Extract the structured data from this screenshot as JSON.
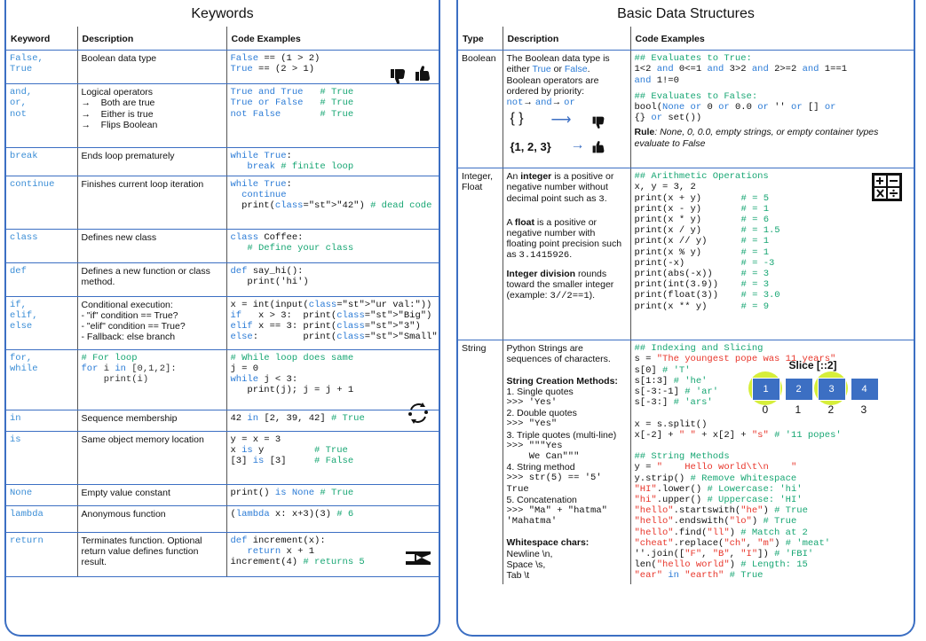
{
  "left": {
    "title": "Keywords",
    "headers": [
      "Keyword",
      "Description",
      "Code Examples"
    ],
    "rows": [
      {
        "kw": "False,\nTrue",
        "desc": "Boolean data type",
        "code": "False == (1 > 2)\nTrue == (2 > 1)"
      },
      {
        "kw": "and,\nor,\nnot",
        "desc": "Logical operators\n→    Both are true\n→    Either is true\n→    Flips Boolean",
        "code": "True and True   # True\nTrue or False   # True\nnot False       # True"
      },
      {
        "kw": "break",
        "desc": "Ends loop prematurely",
        "code": "while True:\n   break # finite loop"
      },
      {
        "kw": "continue",
        "desc": "Finishes current loop iteration",
        "code": "while True:\n  continue\n  print(\"42\") # dead code"
      },
      {
        "kw": "class",
        "desc": "Defines new class",
        "code": "class Coffee:\n   # Define your class"
      },
      {
        "kw": "def",
        "desc": "Defines a new function or class method.",
        "code": "def say_hi():\n   print('hi')"
      },
      {
        "kw": "if,\nelif,\nelse",
        "desc": "Conditional execution:\n- \"if\" condition == True?\n- \"elif\" condition == True?\n- Fallback: else branch",
        "code": "x = int(input(\"ur val:\"))\nif   x > 3:  print(\"Big\")\nelif x == 3: print(\"3\")\nelse:        print(\"Small\")"
      },
      {
        "kw": "for,\nwhile",
        "desc": "# For loop\nfor i in [0,1,2]:\n    print(i)",
        "code": "# While loop does same\nj = 0\nwhile j < 3:\n   print(j); j = j + 1"
      },
      {
        "kw": "in",
        "desc": "Sequence membership",
        "code": "42 in [2, 39, 42] # True"
      },
      {
        "kw": "is",
        "desc": "Same object memory location",
        "code": "y = x = 3\nx is y         # True\n[3] is [3]     # False"
      },
      {
        "kw": "None",
        "desc": "Empty value constant",
        "code": "print() is None # True"
      },
      {
        "kw": "lambda",
        "desc": "Anonymous function",
        "code": "(lambda x: x+3)(3) # 6"
      },
      {
        "kw": "return",
        "desc": "Terminates function. Optional return value defines function result.",
        "code": "def increment(x):\n   return x + 1\nincrement(4) # returns 5"
      }
    ]
  },
  "right": {
    "title": "Basic Data Structures",
    "headers": [
      "Type",
      "Description",
      "Code Examples"
    ],
    "boolean": {
      "type": "Boolean",
      "desc_1": "The Boolean data type is either ",
      "desc_true": "True",
      "desc_or": " or ",
      "desc_false": "False",
      "desc_2": ". Boolean operators are ordered by priority:",
      "order_not": "not",
      "order_and": "and",
      "order_or": "or",
      "set_empty": "{ }",
      "set_full": "{1, 2, 3}",
      "code_c1": "## Evaluates to True:",
      "code_l1": "1<2 and 0<=1 and 3>2 and 2>=2 and 1==1\nand 1!=0",
      "code_c2": "## Evaluates to False:",
      "code_l2": "bool(None or 0 or 0.0 or '' or [] or\n{} or set())",
      "rule_b": "Rule",
      "rule_t": ": None, 0, 0.0, empty strings, or empty container types evaluate to False"
    },
    "number": {
      "type": "Integer,\nFloat",
      "p1a": "An ",
      "p1b": "integer",
      "p1c": " is a positive or negative number without decimal point such as ",
      "p1d": "3",
      "p2a": "A ",
      "p2b": "float",
      "p2c": " is a positive or negative number with floating point precision such as ",
      "p2d": "3.1415926",
      "p3b": "Integer division",
      "p3c": " rounds toward the smaller integer (example: ",
      "p3d": "3//2==1",
      "p3e": ").",
      "code_c": "## Arithmetic Operations",
      "code": [
        [
          "x, y = 3, 2",
          ""
        ],
        [
          "print(x + y)",
          "# = 5"
        ],
        [
          "print(x - y)",
          "# = 1"
        ],
        [
          "print(x * y)",
          "# = 6"
        ],
        [
          "print(x / y)",
          "# = 1.5"
        ],
        [
          "print(x // y)",
          "# = 1"
        ],
        [
          "print(x % y)",
          "# = 1"
        ],
        [
          "print(-x)",
          "# = -3"
        ],
        [
          "print(abs(-x))",
          "# = 3"
        ],
        [
          "print(int(3.9))",
          "# = 3"
        ],
        [
          "print(float(3))",
          "# = 3.0"
        ],
        [
          "print(x ** y)",
          "# = 9"
        ]
      ]
    },
    "string": {
      "type": "String",
      "intro": "Python Strings are sequences of characters.",
      "methods_title": "String Creation Methods:",
      "m1": "1. Single quotes",
      "m1c": ">>> 'Yes'",
      "m2": "2. Double quotes",
      "m2c": ">>> \"Yes\"",
      "m3": "3. Triple quotes (multi-line)",
      "m3c": ">>> \"\"\"Yes\n    We Can\"\"\"",
      "m4": "4. String method",
      "m4c": ">>> str(5) == '5'\nTrue",
      "m5": "5. Concatenation",
      "m5c": ">>> \"Ma\" + \"hatma\"\n'Mahatma'",
      "ws_title": "Whitespace chars:",
      "ws": "Newline \\n,\nSpace \\s,\nTab \\t",
      "c_index": "## Indexing and Slicing",
      "slice_title": "Slice [::2]",
      "slice_boxes": [
        "1",
        "2",
        "3",
        "4"
      ],
      "slice_idx": [
        "0",
        "1",
        "2",
        "3"
      ],
      "c_methods": "## String Methods"
    }
  }
}
